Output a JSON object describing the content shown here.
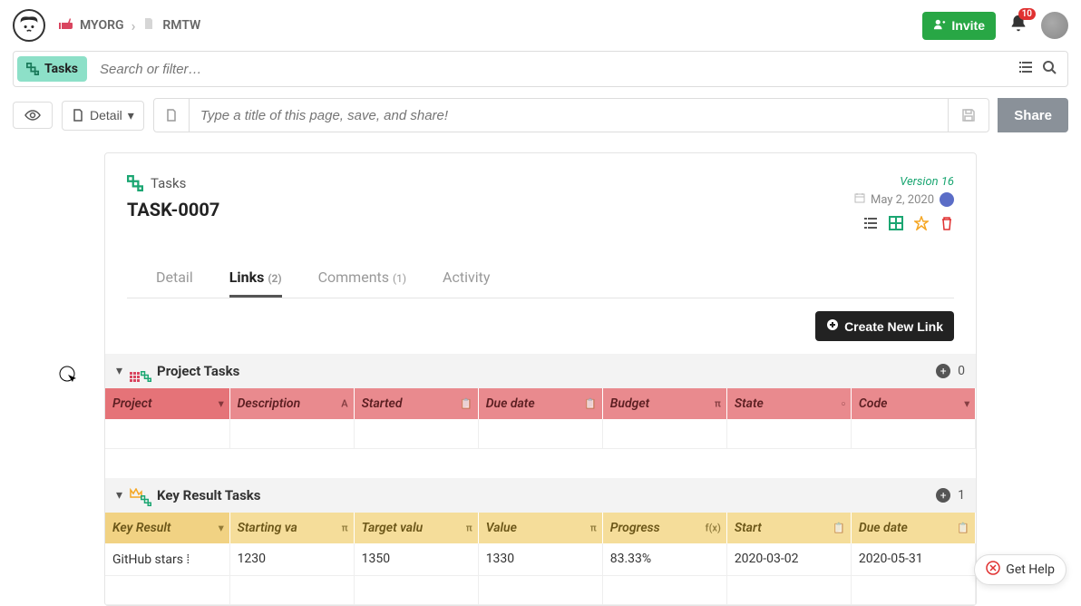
{
  "breadcrumb": {
    "org": "MYORG",
    "project": "RMTW"
  },
  "topbar": {
    "invite": "Invite",
    "notification_count": "10"
  },
  "filterbar": {
    "chip": "Tasks",
    "search_placeholder": "Search or filter…"
  },
  "titlebar": {
    "detail": "Detail",
    "title_placeholder": "Type a title of this page, save, and share!",
    "share": "Share"
  },
  "card": {
    "tasks_label": "Tasks",
    "task_id": "TASK-0007",
    "version": "Version 16",
    "date": "May 2, 2020"
  },
  "tabs": {
    "detail": "Detail",
    "links": "Links",
    "links_count": "(2)",
    "comments": "Comments",
    "comments_count": "(1)",
    "activity": "Activity"
  },
  "create_link": "Create New Link",
  "section1": {
    "title": "Project Tasks",
    "count": "0",
    "cols": [
      "Project",
      "Description",
      "Started",
      "Due date",
      "Budget",
      "State",
      "Code"
    ],
    "colicons": [
      "▾",
      "A",
      "📋",
      "📋",
      "π",
      "▫",
      "▾"
    ]
  },
  "section2": {
    "title": "Key Result Tasks",
    "count": "1",
    "cols": [
      "Key Result",
      "Starting va",
      "Target valu",
      "Value",
      "Progress",
      "Start",
      "Due date"
    ],
    "colicons": [
      "▾",
      "π",
      "π",
      "π",
      "f(x)",
      "📋",
      "📋"
    ],
    "rows": [
      {
        "c0": "GitHub stars ⁞",
        "c1": "1230",
        "c2": "1350",
        "c3": "1330",
        "c4": "83.33%",
        "c5": "2020-03-02",
        "c6": "2020-05-31"
      }
    ]
  },
  "help": "Get Help"
}
